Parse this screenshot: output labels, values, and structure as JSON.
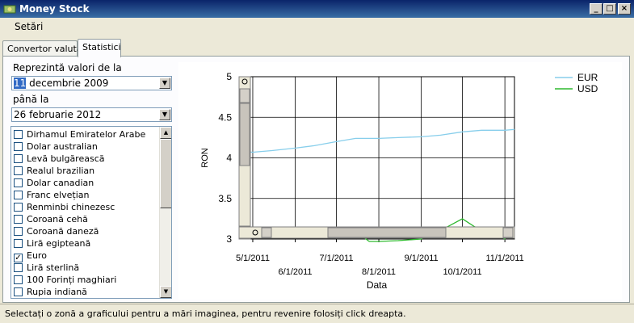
{
  "window": {
    "title": "Money Stock",
    "buttons": {
      "minimize": "_",
      "maximize": "□",
      "close": "×"
    }
  },
  "menu": {
    "items": [
      "Setări"
    ]
  },
  "tabs": [
    "Convertor valutar",
    "Statistici"
  ],
  "active_tab": "Statistici",
  "filters": {
    "from_label": "Reprezintă valori de la",
    "from_day": "11",
    "from_rest": "decembrie 2009",
    "to_label": "până la",
    "to_value": "26  februarie   2012"
  },
  "currencies": [
    {
      "label": "Dirhamul Emiratelor Arabe",
      "checked": false
    },
    {
      "label": "Dolar australian",
      "checked": false
    },
    {
      "label": "Levă bulgărească",
      "checked": false
    },
    {
      "label": "Realul brazilian",
      "checked": false
    },
    {
      "label": "Dolar canadian",
      "checked": false
    },
    {
      "label": "Franc elvețian",
      "checked": false
    },
    {
      "label": "Renminbi chinezesc",
      "checked": false
    },
    {
      "label": "Coroană cehă",
      "checked": false
    },
    {
      "label": "Coroană daneză",
      "checked": false
    },
    {
      "label": "Liră egipteană",
      "checked": false
    },
    {
      "label": "Euro",
      "checked": true
    },
    {
      "label": "Liră sterlină",
      "checked": false
    },
    {
      "label": "100 Forinți maghiari",
      "checked": false
    },
    {
      "label": "Rupia indiană",
      "checked": false
    }
  ],
  "status": {
    "text": "Selectați o zonă a graficului pentru a mări imaginea, pentru revenire folosiți click dreapta."
  },
  "chart_data": {
    "type": "line",
    "xlabel": "Data",
    "ylabel": "RON",
    "ylim": [
      3,
      5
    ],
    "yticks": [
      "3",
      "3.5",
      "4",
      "4.5",
      "5"
    ],
    "xticks": [
      "5/1/2011",
      "6/1/2011",
      "7/1/2011",
      "8/1/2011",
      "9/1/2011",
      "10/1/2011",
      "11/1/2011"
    ],
    "xlim": [
      "2011-04-21",
      "2011-11-08"
    ],
    "grid": true,
    "legend_position": "top-right",
    "series": [
      {
        "name": "EUR",
        "color": "#87ceeb",
        "x": [
          "2011-04-21",
          "2011-05-01",
          "2011-05-15",
          "2011-06-01",
          "2011-06-15",
          "2011-07-01",
          "2011-07-15",
          "2011-08-01",
          "2011-08-15",
          "2011-09-01",
          "2011-09-15",
          "2011-10-01",
          "2011-10-15",
          "2011-11-01",
          "2011-11-08"
        ],
        "values": [
          4.08,
          4.07,
          4.09,
          4.12,
          4.15,
          4.2,
          4.24,
          4.24,
          4.25,
          4.26,
          4.28,
          4.32,
          4.34,
          4.34,
          4.35
        ]
      },
      {
        "name": "USD",
        "color": "#2eb82e",
        "x": [
          "2011-07-21",
          "2011-07-25",
          "2011-08-01",
          "2011-08-15",
          "2011-09-01",
          "2011-09-10",
          "2011-09-20",
          "2011-10-01",
          "2011-10-10",
          "2011-10-20",
          "2011-11-01",
          "2011-11-08"
        ],
        "values": [
          3.02,
          2.97,
          2.97,
          2.98,
          3.0,
          3.1,
          3.15,
          3.25,
          3.15,
          3.1,
          3.0,
          3.14
        ]
      }
    ]
  },
  "colors": {
    "accent": "#316ac5",
    "eur": "#87ceeb",
    "usd": "#2eb82e"
  }
}
